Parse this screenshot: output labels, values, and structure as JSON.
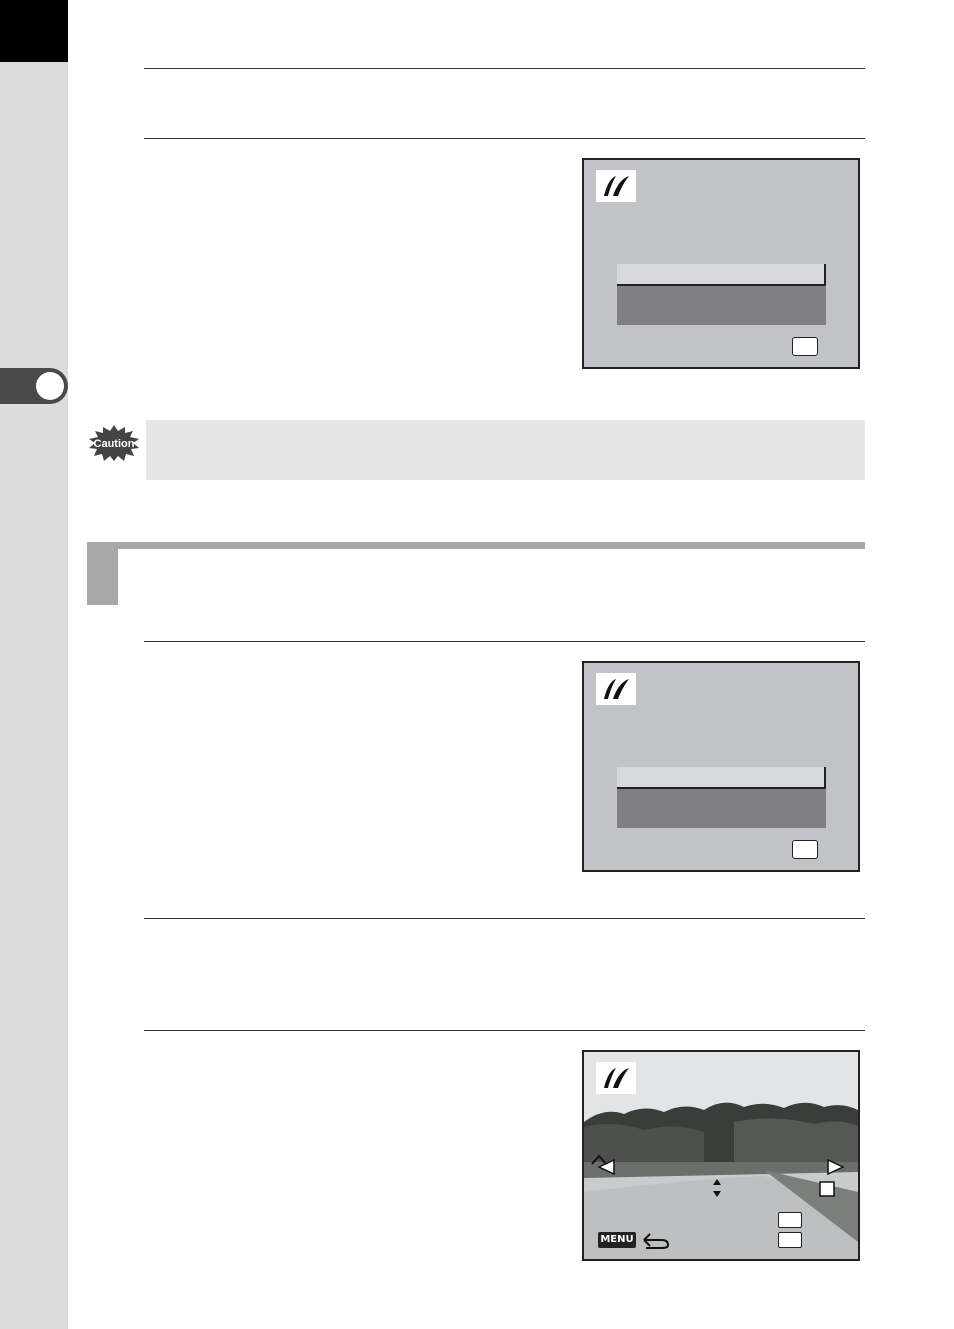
{
  "manual": {
    "caution": {
      "badge": "Caution"
    },
    "photo_screen": {
      "menu_key": "MENU"
    }
  }
}
